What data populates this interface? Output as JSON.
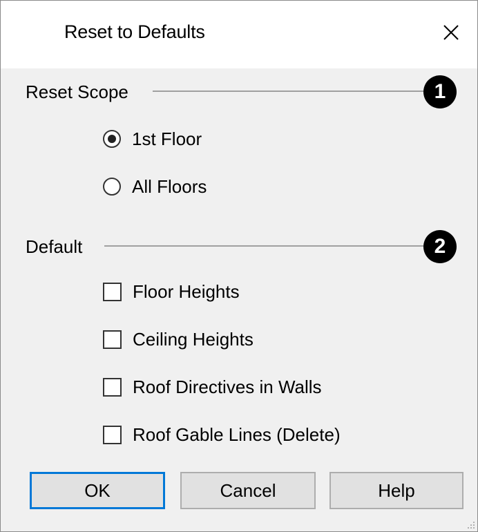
{
  "dialog": {
    "title": "Reset to Defaults",
    "close_icon": "close-icon"
  },
  "reset_scope": {
    "label": "Reset Scope",
    "callout": "1",
    "options": [
      {
        "label": "1st Floor",
        "selected": true
      },
      {
        "label": "All Floors",
        "selected": false
      }
    ]
  },
  "default_group": {
    "label": "Default",
    "callout": "2",
    "options": [
      {
        "label": "Floor Heights",
        "checked": false
      },
      {
        "label": "Ceiling Heights",
        "checked": false
      },
      {
        "label": "Roof Directives in Walls",
        "checked": false
      },
      {
        "label": "Roof Gable Lines (Delete)",
        "checked": false
      }
    ]
  },
  "buttons": {
    "ok": "OK",
    "cancel": "Cancel",
    "help": "Help"
  },
  "colors": {
    "default_button_border": "#0078d7",
    "dialog_background": "#f0f0f0",
    "titlebar_background": "#ffffff"
  }
}
